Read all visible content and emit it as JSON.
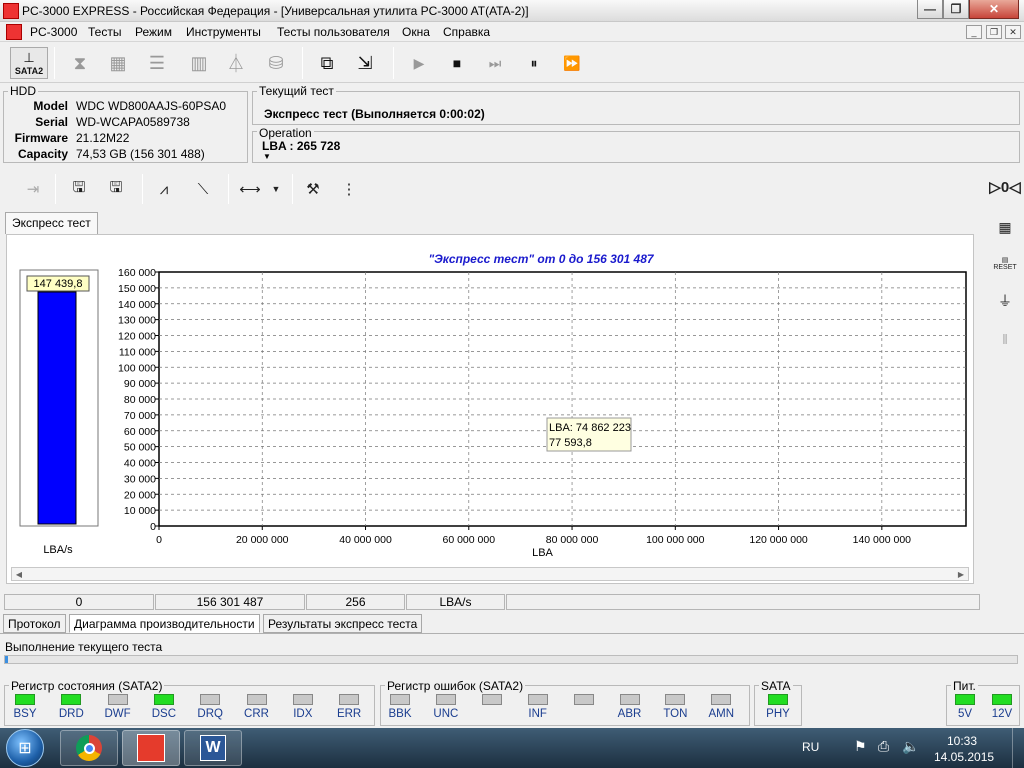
{
  "window": {
    "title": "PC-3000 EXPRESS - Российская Федерация - [Универсальная утилита PC-3000 AT(ATA-2)]"
  },
  "menu": [
    "PC-3000",
    "Тесты",
    "Режим",
    "Инструменты",
    "Тесты пользователя",
    "Окна",
    "Справка"
  ],
  "toolbar": {
    "sata_label": "SATA2"
  },
  "hdd": {
    "caption": "HDD",
    "model_label": "Model",
    "model": "WDC WD800AAJS-60PSA0",
    "serial_label": "Serial",
    "serial": "WD-WCAPA0589738",
    "firmware_label": "Firmware",
    "firmware": "21.12M22",
    "capacity_label": "Capacity",
    "capacity": "74,53 GB (156 301 488)"
  },
  "current_test": {
    "caption": "Текущий тест",
    "value": "Экспресс тест (Выполняется 0:00:02)"
  },
  "operation": {
    "caption": "Operation",
    "value": "LBA : 265 728"
  },
  "test_tab": "Экспресс тест",
  "chart_data": {
    "type": "line",
    "title": "\"Экспресс тест\" от 0 до 156 301 487",
    "xlabel": "LBA",
    "ylabel": "",
    "xlim": [
      0,
      156301487
    ],
    "ylim": [
      0,
      160000
    ],
    "x_ticks": [
      "0",
      "20 000 000",
      "40 000 000",
      "60 000 000",
      "80 000 000",
      "100 000 000",
      "120 000 000",
      "140 000 000"
    ],
    "y_ticks": [
      "0",
      "10 000",
      "20 000",
      "30 000",
      "40 000",
      "50 000",
      "60 000",
      "70 000",
      "80 000",
      "90 000",
      "100 000",
      "110 000",
      "120 000",
      "130 000",
      "140 000",
      "150 000",
      "160 000"
    ],
    "grid": true,
    "bar_indicator": {
      "value": 147439.8,
      "label": "147 439,8",
      "unit": "LBA/s",
      "max": 160000
    },
    "tooltip": {
      "line1": "LBA: 74 862 223",
      "line2": "77 593,8"
    }
  },
  "status_row": [
    "0",
    "156 301 487",
    "256",
    "LBA/s"
  ],
  "bottom_tabs": [
    "Протокол",
    "Диаграмма производительности",
    "Результаты экспресс теста"
  ],
  "progress": {
    "label": "Выполнение текущего теста",
    "fraction": 0.003
  },
  "registers": {
    "status_caption": "Регистр состояния (SATA2)",
    "status": [
      {
        "name": "BSY",
        "on": true
      },
      {
        "name": "DRD",
        "on": true
      },
      {
        "name": "DWF",
        "on": false
      },
      {
        "name": "DSC",
        "on": true
      },
      {
        "name": "DRQ",
        "on": false
      },
      {
        "name": "CRR",
        "on": false
      },
      {
        "name": "IDX",
        "on": false
      },
      {
        "name": "ERR",
        "on": false
      }
    ],
    "error_caption": "Регистр ошибок  (SATA2)",
    "error": [
      {
        "name": "BBK",
        "on": false
      },
      {
        "name": "UNC",
        "on": false
      },
      {
        "name": "",
        "on": false
      },
      {
        "name": "INF",
        "on": false
      },
      {
        "name": "",
        "on": false
      },
      {
        "name": "ABR",
        "on": false
      },
      {
        "name": "TON",
        "on": false
      },
      {
        "name": "AMN",
        "on": false
      }
    ],
    "sata_caption": "SATA",
    "sata": [
      {
        "name": "PHY",
        "on": true
      }
    ],
    "power_caption": "Пит.",
    "power": [
      {
        "name": "5V",
        "on": true
      },
      {
        "name": "12V",
        "on": true
      }
    ]
  },
  "taskbar": {
    "lang": "RU",
    "time": "10:33",
    "date": "14.05.2015"
  },
  "colors": {
    "accent_blue": "#0000ff",
    "title_blue": "#1a1acd",
    "led_on": "#22dd22"
  }
}
